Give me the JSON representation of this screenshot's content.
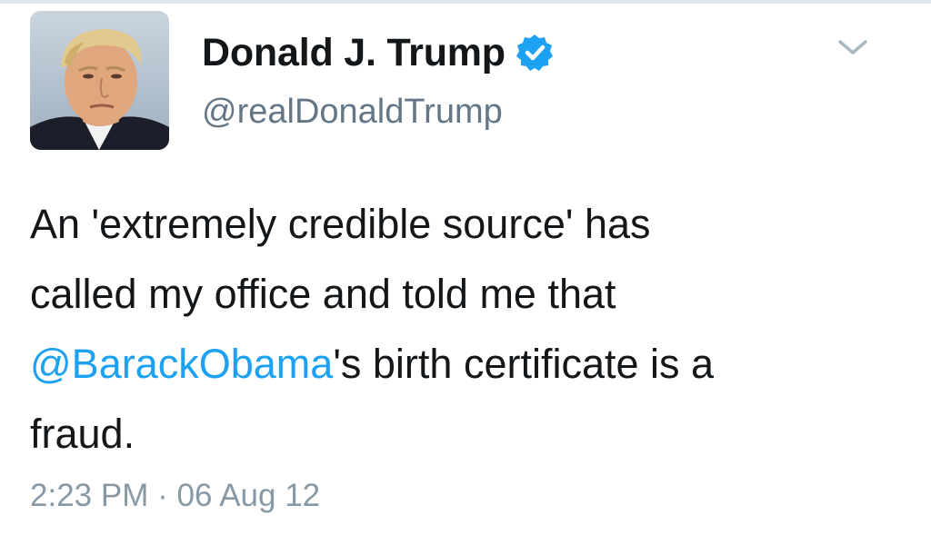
{
  "tweet": {
    "author": {
      "display_name": "Donald J. Trump",
      "handle": "@realDonaldTrump",
      "verified_icon": "verified-badge-icon"
    },
    "menu_icon": "chevron-down-icon",
    "text": {
      "line1": "An 'extremely credible source' has",
      "line2": "called my office and told me that",
      "mention": "@BarackObama",
      "line3_rest": "'s birth certificate is a",
      "line4": "fraud."
    },
    "timestamp": {
      "time": "2:23 PM",
      "separator": "·",
      "date": "06 Aug 12"
    }
  },
  "colors": {
    "text_primary": "#14171a",
    "text_secondary": "#657786",
    "link": "#1da1f2",
    "verified": "#1da1f2",
    "timestamp": "#8899a6"
  }
}
